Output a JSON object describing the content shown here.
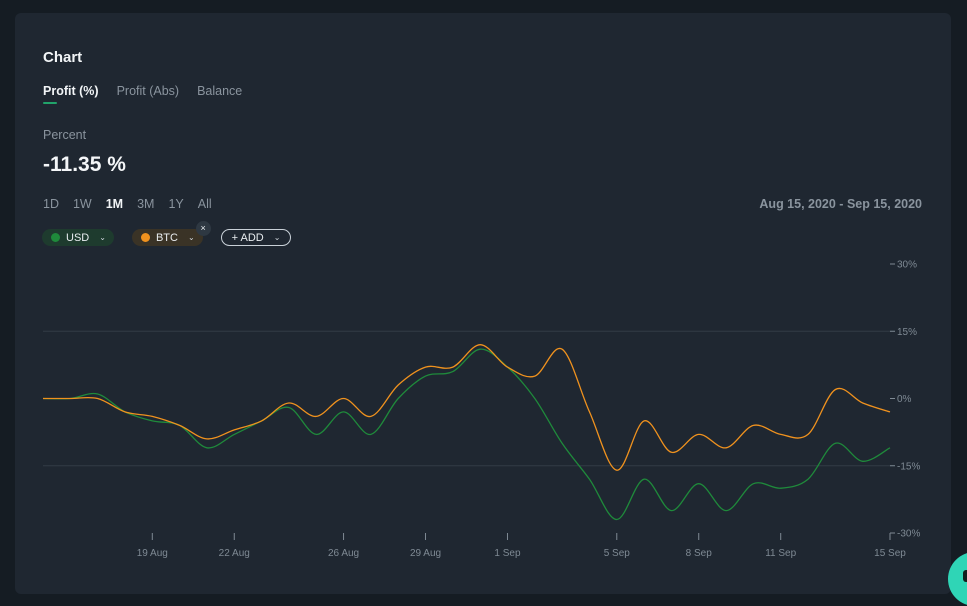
{
  "card": {
    "title": "Chart",
    "tabs": [
      {
        "label": "Profit (%)",
        "active": true
      },
      {
        "label": "Profit (Abs)",
        "active": false
      },
      {
        "label": "Balance",
        "active": false
      }
    ],
    "metric_label": "Percent",
    "metric_value": "-11.35 %",
    "ranges": [
      {
        "label": "1D",
        "active": false
      },
      {
        "label": "1W",
        "active": false
      },
      {
        "label": "1M",
        "active": true
      },
      {
        "label": "3M",
        "active": false
      },
      {
        "label": "1Y",
        "active": false
      },
      {
        "label": "All",
        "active": false
      }
    ],
    "date_range": "Aug 15, 2020 - Sep 15, 2020",
    "pills": {
      "usd": {
        "label": "USD",
        "color": "#1f8a3b"
      },
      "btc": {
        "label": "BTC",
        "color": "#f0921e",
        "remove": "×"
      },
      "add": {
        "label": "+ ADD"
      }
    }
  },
  "colors": {
    "accent": "#21a36a",
    "usd_line": "#1f8a3b",
    "btc_line": "#f0921e",
    "grid": "#323c46",
    "axis_text": "#7f8a94"
  },
  "chart_data": {
    "type": "line",
    "xlabel": "",
    "ylabel": "",
    "ylim": [
      -30,
      30
    ],
    "xlim": [
      "2020-08-15",
      "2020-09-15"
    ],
    "y_ticks": [
      {
        "value": 30,
        "label": "30%"
      },
      {
        "value": 15,
        "label": "15%"
      },
      {
        "value": 0,
        "label": "0%"
      },
      {
        "value": -15,
        "label": "-15%"
      },
      {
        "value": -30,
        "label": "-30%"
      }
    ],
    "x_ticks": [
      {
        "date": "2020-08-19",
        "label": "19 Aug"
      },
      {
        "date": "2020-08-22",
        "label": "22 Aug"
      },
      {
        "date": "2020-08-26",
        "label": "26 Aug"
      },
      {
        "date": "2020-08-29",
        "label": "29 Aug"
      },
      {
        "date": "2020-09-01",
        "label": "1 Sep"
      },
      {
        "date": "2020-09-05",
        "label": "5 Sep"
      },
      {
        "date": "2020-09-08",
        "label": "8 Sep"
      },
      {
        "date": "2020-09-11",
        "label": "11 Sep"
      },
      {
        "date": "2020-09-15",
        "label": "15 Sep"
      }
    ],
    "x": [
      "2020-08-15",
      "2020-08-16",
      "2020-08-17",
      "2020-08-18",
      "2020-08-19",
      "2020-08-20",
      "2020-08-21",
      "2020-08-22",
      "2020-08-23",
      "2020-08-24",
      "2020-08-25",
      "2020-08-26",
      "2020-08-27",
      "2020-08-28",
      "2020-08-29",
      "2020-08-30",
      "2020-08-31",
      "2020-09-01",
      "2020-09-02",
      "2020-09-03",
      "2020-09-04",
      "2020-09-05",
      "2020-09-06",
      "2020-09-07",
      "2020-09-08",
      "2020-09-09",
      "2020-09-10",
      "2020-09-11",
      "2020-09-12",
      "2020-09-13",
      "2020-09-14",
      "2020-09-15"
    ],
    "series": [
      {
        "name": "USD",
        "color": "#1f8a3b",
        "values": [
          0,
          0,
          1,
          -3,
          -5,
          -6,
          -11,
          -8,
          -5,
          -2,
          -8,
          -3,
          -8,
          0,
          5,
          6,
          11,
          7,
          0,
          -10,
          -18,
          -27,
          -18,
          -25,
          -19,
          -25,
          -19,
          -20,
          -18,
          -10,
          -14,
          -11
        ]
      },
      {
        "name": "BTC",
        "color": "#f0921e",
        "values": [
          0,
          0,
          0,
          -3,
          -4,
          -6,
          -9,
          -7,
          -5,
          -1,
          -4,
          0,
          -4,
          3,
          7,
          7,
          12,
          7,
          5,
          11,
          -3,
          -16,
          -5,
          -12,
          -8,
          -11,
          -6,
          -8,
          -8,
          2,
          -1,
          -3
        ]
      }
    ]
  }
}
